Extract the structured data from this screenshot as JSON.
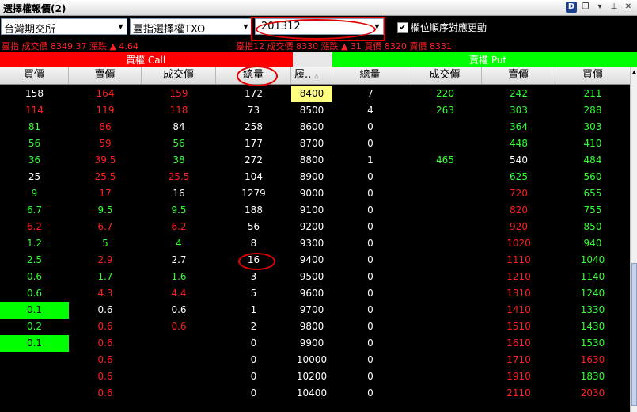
{
  "window": {
    "title": "選擇權報價(2)",
    "d_label": "D"
  },
  "controls": {
    "exchange": "台灣期交所",
    "product": "臺指選擇權TXO",
    "month": "201312",
    "checkbox_label": "欄位順序對應更動",
    "checkbox_checked": "✔"
  },
  "ticker": {
    "left": "臺指  成交價 8349.37  漲跌 ▲ 4.64",
    "right": "臺指12  成交價 8330  漲跌 ▲ 31  買價 8320  賣價 8331"
  },
  "sections": {
    "call": "買權 Call",
    "put": "賣權 Put"
  },
  "columns": [
    "買價",
    "賣價",
    "成交價",
    "總量",
    "履..",
    "總量",
    "成交價",
    "賣價",
    "買價"
  ],
  "rows": [
    [
      "158",
      "164",
      "159",
      "172",
      "8400",
      "7",
      "220",
      "242",
      "211"
    ],
    [
      "114",
      "119",
      "118",
      "73",
      "8500",
      "4",
      "263",
      "303",
      "288"
    ],
    [
      "81",
      "86",
      "84",
      "258",
      "8600",
      "0",
      "",
      "364",
      "303"
    ],
    [
      "56",
      "59",
      "56",
      "177",
      "8700",
      "0",
      "",
      "448",
      "410"
    ],
    [
      "36",
      "39.5",
      "38",
      "272",
      "8800",
      "1",
      "465",
      "540",
      "484"
    ],
    [
      "25",
      "25.5",
      "25.5",
      "104",
      "8900",
      "0",
      "",
      "625",
      "560"
    ],
    [
      "9",
      "17",
      "16",
      "1279",
      "9000",
      "0",
      "",
      "720",
      "655"
    ],
    [
      "6.7",
      "9.5",
      "9.5",
      "188",
      "9100",
      "0",
      "",
      "820",
      "755"
    ],
    [
      "6.2",
      "6.7",
      "6.2",
      "56",
      "9200",
      "0",
      "",
      "920",
      "850"
    ],
    [
      "1.2",
      "5",
      "4",
      "8",
      "9300",
      "0",
      "",
      "1020",
      "940"
    ],
    [
      "2.5",
      "2.9",
      "2.7",
      "16",
      "9400",
      "0",
      "",
      "1110",
      "1040"
    ],
    [
      "0.6",
      "1.7",
      "1.6",
      "3",
      "9500",
      "0",
      "",
      "1210",
      "1140"
    ],
    [
      "0.6",
      "4.3",
      "4.4",
      "5",
      "9600",
      "0",
      "",
      "1310",
      "1240"
    ],
    [
      "0.1",
      "0.6",
      "0.6",
      "1",
      "9700",
      "0",
      "",
      "1410",
      "1330"
    ],
    [
      "0.2",
      "0.6",
      "0.6",
      "2",
      "9800",
      "0",
      "",
      "1510",
      "1430"
    ],
    [
      "0.1",
      "0.6",
      "",
      "0",
      "9900",
      "0",
      "",
      "1610",
      "1530"
    ],
    [
      "",
      "0.6",
      "",
      "0",
      "10000",
      "0",
      "",
      "1710",
      "1630"
    ],
    [
      "",
      "0.6",
      "",
      "0",
      "10200",
      "0",
      "",
      "1910",
      "1830"
    ],
    [
      "",
      "0.6",
      "",
      "0",
      "10400",
      "0",
      "",
      "2110",
      "2030"
    ]
  ],
  "row_colors": [
    [
      "w",
      "r",
      "r",
      "w",
      "k",
      "w",
      "g",
      "g",
      "g"
    ],
    [
      "r",
      "r",
      "r",
      "w",
      "w",
      "w",
      "g",
      "g",
      "g"
    ],
    [
      "g",
      "r",
      "w",
      "w",
      "w",
      "w",
      "g",
      "g",
      "g"
    ],
    [
      "g",
      "r",
      "g",
      "w",
      "w",
      "w",
      "g",
      "g",
      "g"
    ],
    [
      "g",
      "r",
      "g",
      "w",
      "w",
      "w",
      "g",
      "w",
      "g"
    ],
    [
      "w",
      "r",
      "r",
      "w",
      "w",
      "w",
      "g",
      "g",
      "g"
    ],
    [
      "g",
      "r",
      "w",
      "w",
      "w",
      "w",
      "g",
      "r",
      "g"
    ],
    [
      "g",
      "g",
      "g",
      "w",
      "w",
      "w",
      "g",
      "r",
      "g"
    ],
    [
      "r",
      "r",
      "r",
      "w",
      "w",
      "w",
      "g",
      "r",
      "g"
    ],
    [
      "g",
      "g",
      "g",
      "w",
      "w",
      "w",
      "g",
      "r",
      "g"
    ],
    [
      "g",
      "r",
      "w",
      "w",
      "w",
      "w",
      "g",
      "r",
      "g"
    ],
    [
      "g",
      "g",
      "g",
      "w",
      "w",
      "w",
      "g",
      "r",
      "g"
    ],
    [
      "g",
      "r",
      "r",
      "w",
      "w",
      "w",
      "g",
      "r",
      "g"
    ],
    [
      "G",
      "w",
      "w",
      "w",
      "w",
      "w",
      "g",
      "r",
      "g"
    ],
    [
      "g",
      "r",
      "r",
      "w",
      "w",
      "w",
      "g",
      "r",
      "g"
    ],
    [
      "G",
      "r",
      "w",
      "w",
      "w",
      "w",
      "g",
      "r",
      "g"
    ],
    [
      "w",
      "r",
      "w",
      "w",
      "w",
      "w",
      "g",
      "r",
      "r"
    ],
    [
      "w",
      "r",
      "w",
      "w",
      "w",
      "w",
      "g",
      "r",
      "g"
    ],
    [
      "w",
      "r",
      "w",
      "w",
      "w",
      "w",
      "g",
      "r",
      "r"
    ]
  ],
  "colors": {
    "call": "#ff0000",
    "put": "#00ff00",
    "up": "#ff2020",
    "down": "#33ff33",
    "highlight": "#ffff80"
  }
}
